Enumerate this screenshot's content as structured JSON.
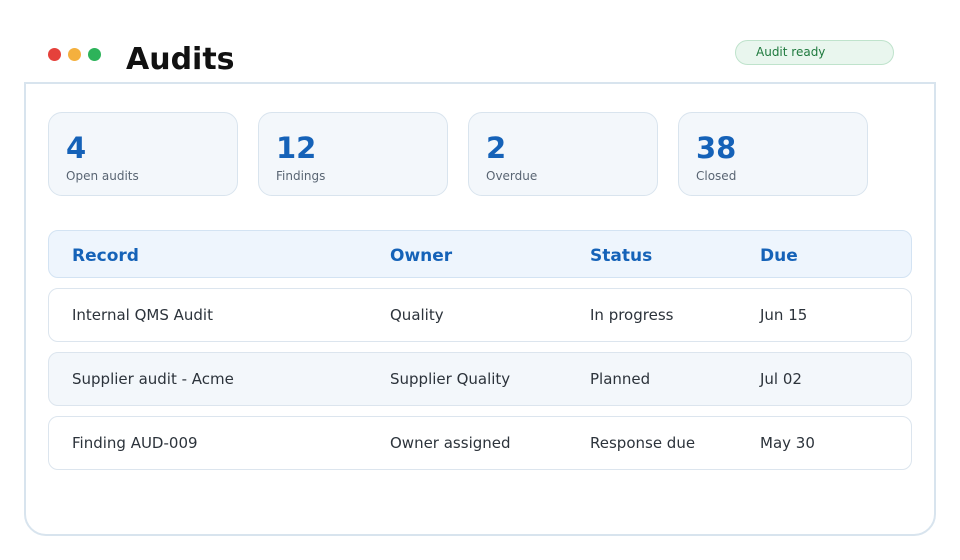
{
  "window": {
    "title": "Audits",
    "status_badge": "Audit ready"
  },
  "stats": [
    {
      "value": "4",
      "label": "Open audits"
    },
    {
      "value": "12",
      "label": "Findings"
    },
    {
      "value": "2",
      "label": "Overdue"
    },
    {
      "value": "38",
      "label": "Closed"
    }
  ],
  "table": {
    "columns": [
      "Record",
      "Owner",
      "Status",
      "Due"
    ],
    "rows": [
      {
        "record": "Internal QMS Audit",
        "owner": "Quality",
        "status": "In progress",
        "due": "Jun 15"
      },
      {
        "record": "Supplier audit - Acme",
        "owner": "Supplier Quality",
        "status": "Planned",
        "due": "Jul 02"
      },
      {
        "record": "Finding AUD-009",
        "owner": "Owner assigned",
        "status": "Response due",
        "due": "May 30"
      }
    ]
  },
  "colors": {
    "accent": "#1562b8",
    "badge_bg": "#e9f6ee",
    "badge_text": "#1f7a3e",
    "window_close": "#e5413b",
    "window_minimize": "#f4b03e",
    "window_maximize": "#2db35a"
  }
}
